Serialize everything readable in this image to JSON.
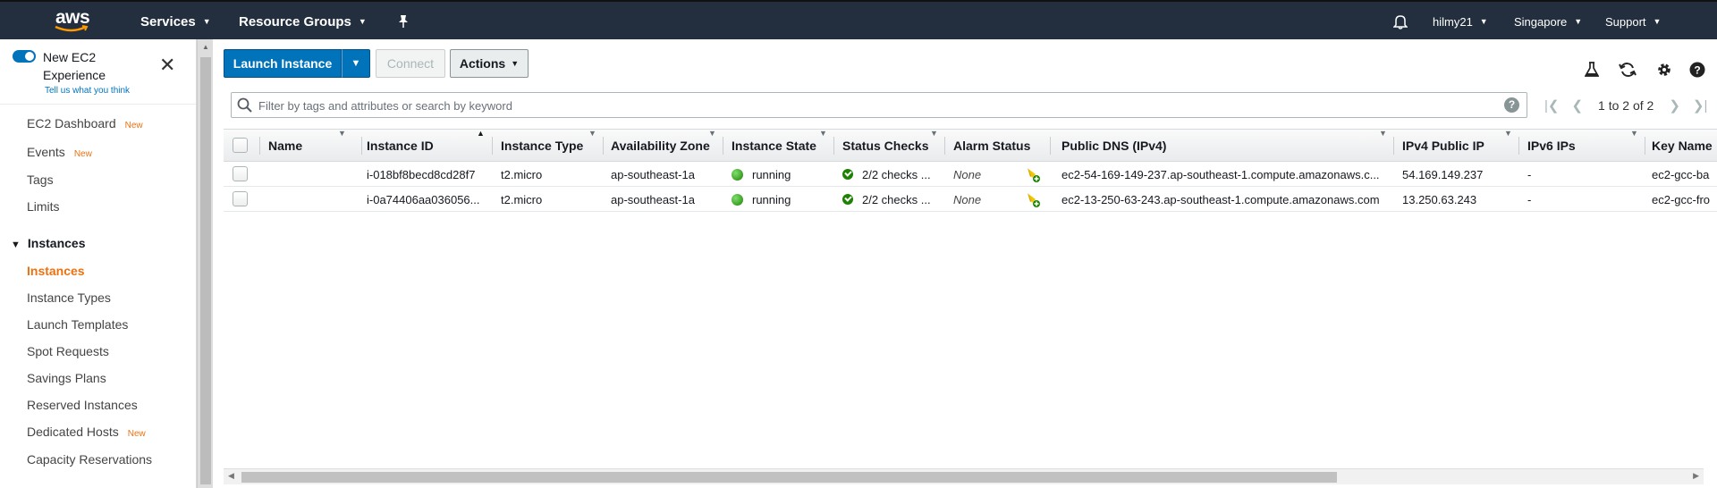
{
  "topnav": {
    "logo": "aws",
    "services": "Services",
    "resource_groups": "Resource Groups",
    "user": "hilmy21",
    "region": "Singapore",
    "support": "Support"
  },
  "sidebar": {
    "toggle_label": "New EC2 Experience",
    "feedback": "Tell us what you think",
    "items_top": [
      {
        "label": "EC2 Dashboard",
        "badge": "New"
      },
      {
        "label": "Events",
        "badge": "New"
      },
      {
        "label": "Tags",
        "badge": ""
      },
      {
        "label": "Limits",
        "badge": ""
      }
    ],
    "section": "Instances",
    "items_instances": [
      {
        "label": "Instances",
        "badge": ""
      },
      {
        "label": "Instance Types",
        "badge": ""
      },
      {
        "label": "Launch Templates",
        "badge": ""
      },
      {
        "label": "Spot Requests",
        "badge": ""
      },
      {
        "label": "Savings Plans",
        "badge": ""
      },
      {
        "label": "Reserved Instances",
        "badge": ""
      },
      {
        "label": "Dedicated Hosts",
        "badge": "New"
      },
      {
        "label": "Capacity Reservations",
        "badge": ""
      }
    ]
  },
  "toolbar": {
    "launch": "Launch Instance",
    "connect": "Connect",
    "actions": "Actions"
  },
  "filter": {
    "placeholder": "Filter by tags and attributes or search by keyword",
    "pager": "1 to 2 of 2"
  },
  "table": {
    "headers": {
      "name": "Name",
      "instance_id": "Instance ID",
      "instance_type": "Instance Type",
      "az": "Availability Zone",
      "state": "Instance State",
      "status_checks": "Status Checks",
      "alarm_status": "Alarm Status",
      "public_dns": "Public DNS (IPv4)",
      "ipv4": "IPv4 Public IP",
      "ipv6": "IPv6 IPs",
      "key_name": "Key Name"
    },
    "rows": [
      {
        "name": "",
        "instance_id": "i-018bf8becd8cd28f7",
        "instance_type": "t2.micro",
        "az": "ap-southeast-1a",
        "state": "running",
        "status_checks": "2/2 checks ...",
        "alarm_status": "None",
        "public_dns": "ec2-54-169-149-237.ap-southeast-1.compute.amazonaws.c...",
        "ipv4": "54.169.149.237",
        "ipv6": "-",
        "key_name": "ec2-gcc-ba"
      },
      {
        "name": "",
        "instance_id": "i-0a74406aa036056...",
        "instance_type": "t2.micro",
        "az": "ap-southeast-1a",
        "state": "running",
        "status_checks": "2/2 checks ...",
        "alarm_status": "None",
        "public_dns": "ec2-13-250-63-243.ap-southeast-1.compute.amazonaws.com",
        "ipv4": "13.250.63.243",
        "ipv6": "-",
        "key_name": "ec2-gcc-fro"
      }
    ]
  },
  "colors": {
    "nav_bg": "#232f3e",
    "primary": "#0073bb",
    "accent": "#ec7211",
    "running": "#1d8102"
  }
}
